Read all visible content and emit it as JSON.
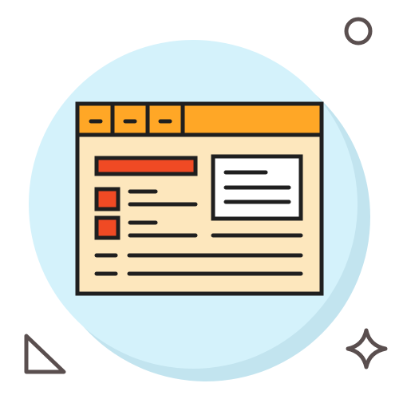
{
  "illustration": {
    "subject": "browser-window-icon",
    "colors": {
      "background": "#ffffff",
      "circle_light": "#d4f2fb",
      "circle_shadow": "#c2e4ef",
      "outline": "#1f1f1f",
      "window_fill": "#fde7bd",
      "toolbar": "#ffa726",
      "accent_red": "#f04a24",
      "panel": "#ffffff",
      "decor": "#5a4f4f"
    },
    "window": {
      "toolbar_tabs": 3,
      "checkbox_items": 2,
      "text_lines": 2
    },
    "decorations": [
      "circle-outline",
      "triangle-outline",
      "sparkle-outline"
    ]
  }
}
